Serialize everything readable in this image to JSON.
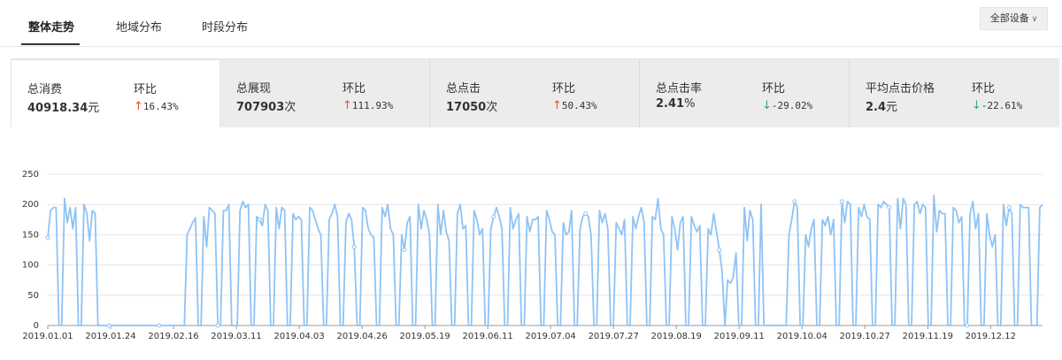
{
  "tabs": [
    {
      "label": "整体走势",
      "active": true
    },
    {
      "label": "地域分布",
      "active": false
    },
    {
      "label": "时段分布",
      "active": false
    }
  ],
  "device_select": {
    "label": "全部设备",
    "icon": "chevron-down-icon"
  },
  "kpis": [
    {
      "label": "总消费",
      "value": "40918.34",
      "unit": "元",
      "ratio_label": "环比",
      "direction": "up",
      "ratio": "16.43%",
      "active": true
    },
    {
      "label": "总展现",
      "value": "707903",
      "unit": "次",
      "ratio_label": "环比",
      "direction": "up",
      "ratio": "111.93%",
      "active": false
    },
    {
      "label": "总点击",
      "value": "17050",
      "unit": "次",
      "ratio_label": "环比",
      "direction": "up",
      "ratio": "50.43%",
      "active": false
    },
    {
      "label": "总点击率",
      "value": "2.41",
      "unit": "%",
      "ratio_label": "环比",
      "direction": "down",
      "ratio": "-29.02%",
      "active": false
    },
    {
      "label": "平均点击价格",
      "value": "2.4",
      "unit": "元",
      "ratio_label": "环比",
      "direction": "down",
      "ratio": "-22.61%",
      "active": false
    }
  ],
  "colors": {
    "line": "#8fc3f5",
    "up": "#e8532c",
    "down": "#3aa76d",
    "grid": "#e6e6e6"
  },
  "chart_data": {
    "type": "line",
    "title": "",
    "xlabel": "",
    "ylabel": "",
    "ylim": [
      0,
      250
    ],
    "yticks": [
      0,
      50,
      100,
      150,
      200,
      250
    ],
    "xtick_labels": [
      "2019.01.01",
      "2019.01.24",
      "2019.02.16",
      "2019.03.11",
      "2019.04.03",
      "2019.04.26",
      "2019.05.19",
      "2019.06.11",
      "2019.07.04",
      "2019.07.27",
      "2019.08.19",
      "2019.09.11",
      "2019.10.04",
      "2019.10.27",
      "2019.11.19",
      "2019.12.12"
    ],
    "grid": true,
    "x_start": "2019.01.01",
    "x_end": "2019.12.31",
    "series": [
      {
        "values": [
          145,
          190,
          195,
          195,
          0,
          0,
          210,
          170,
          195,
          160,
          195,
          0,
          0,
          200,
          185,
          140,
          190,
          185,
          0,
          0,
          0,
          0,
          0,
          0,
          0,
          0,
          0,
          0,
          0,
          0,
          0,
          0,
          0,
          0,
          0,
          0,
          0,
          0,
          0,
          0,
          0,
          0,
          0,
          0,
          0,
          0,
          0,
          0,
          0,
          0,
          150,
          160,
          170,
          178,
          0,
          0,
          180,
          130,
          195,
          190,
          185,
          0,
          0,
          190,
          190,
          200,
          0,
          0,
          0,
          190,
          205,
          195,
          200,
          0,
          0,
          180,
          175,
          165,
          200,
          190,
          0,
          0,
          195,
          160,
          195,
          190,
          0,
          0,
          185,
          175,
          180,
          175,
          0,
          0,
          195,
          190,
          175,
          160,
          150,
          0,
          0,
          175,
          185,
          200,
          180,
          0,
          0,
          170,
          185,
          175,
          130,
          0,
          0,
          195,
          190,
          160,
          150,
          145,
          0,
          0,
          195,
          180,
          200,
          160,
          150,
          0,
          0,
          150,
          125,
          170,
          180,
          0,
          0,
          200,
          160,
          190,
          175,
          150,
          0,
          0,
          200,
          150,
          190,
          155,
          140,
          0,
          0,
          185,
          200,
          160,
          165,
          0,
          0,
          190,
          175,
          150,
          160,
          0,
          0,
          160,
          180,
          195,
          180,
          160,
          0,
          0,
          195,
          160,
          175,
          185,
          0,
          0,
          180,
          155,
          175,
          175,
          180,
          0,
          0,
          190,
          175,
          155,
          150,
          0,
          0,
          170,
          150,
          155,
          190,
          0,
          0,
          160,
          180,
          185,
          180,
          150,
          0,
          0,
          190,
          170,
          185,
          160,
          0,
          0,
          170,
          160,
          150,
          175,
          0,
          0,
          180,
          160,
          180,
          195,
          170,
          0,
          0,
          180,
          175,
          210,
          160,
          150,
          0,
          0,
          180,
          160,
          125,
          170,
          180,
          0,
          0,
          180,
          165,
          155,
          165,
          0,
          0,
          160,
          150,
          185,
          155,
          125,
          90,
          0,
          75,
          70,
          80,
          120,
          0,
          0,
          195,
          140,
          190,
          175,
          0,
          0,
          200,
          0,
          0,
          0,
          0,
          0,
          0,
          0,
          0,
          0,
          150,
          175,
          205,
          195,
          0,
          0,
          150,
          130,
          160,
          175,
          0,
          0,
          175,
          165,
          180,
          150,
          175,
          0,
          0,
          205,
          170,
          205,
          200,
          0,
          0,
          195,
          180,
          200,
          180,
          175,
          0,
          0,
          200,
          195,
          205,
          200,
          195,
          0,
          0,
          210,
          160,
          210,
          200,
          0,
          0,
          200,
          205,
          185,
          200,
          195,
          0,
          0,
          215,
          155,
          190,
          185,
          185,
          0,
          0,
          195,
          190,
          170,
          180,
          0,
          0,
          185,
          205,
          160,
          185,
          0,
          0,
          185,
          150,
          130,
          150,
          0,
          0,
          200,
          165,
          195,
          185,
          0,
          0,
          200,
          195,
          195,
          195,
          0,
          0,
          0,
          195,
          200
        ]
      }
    ]
  }
}
